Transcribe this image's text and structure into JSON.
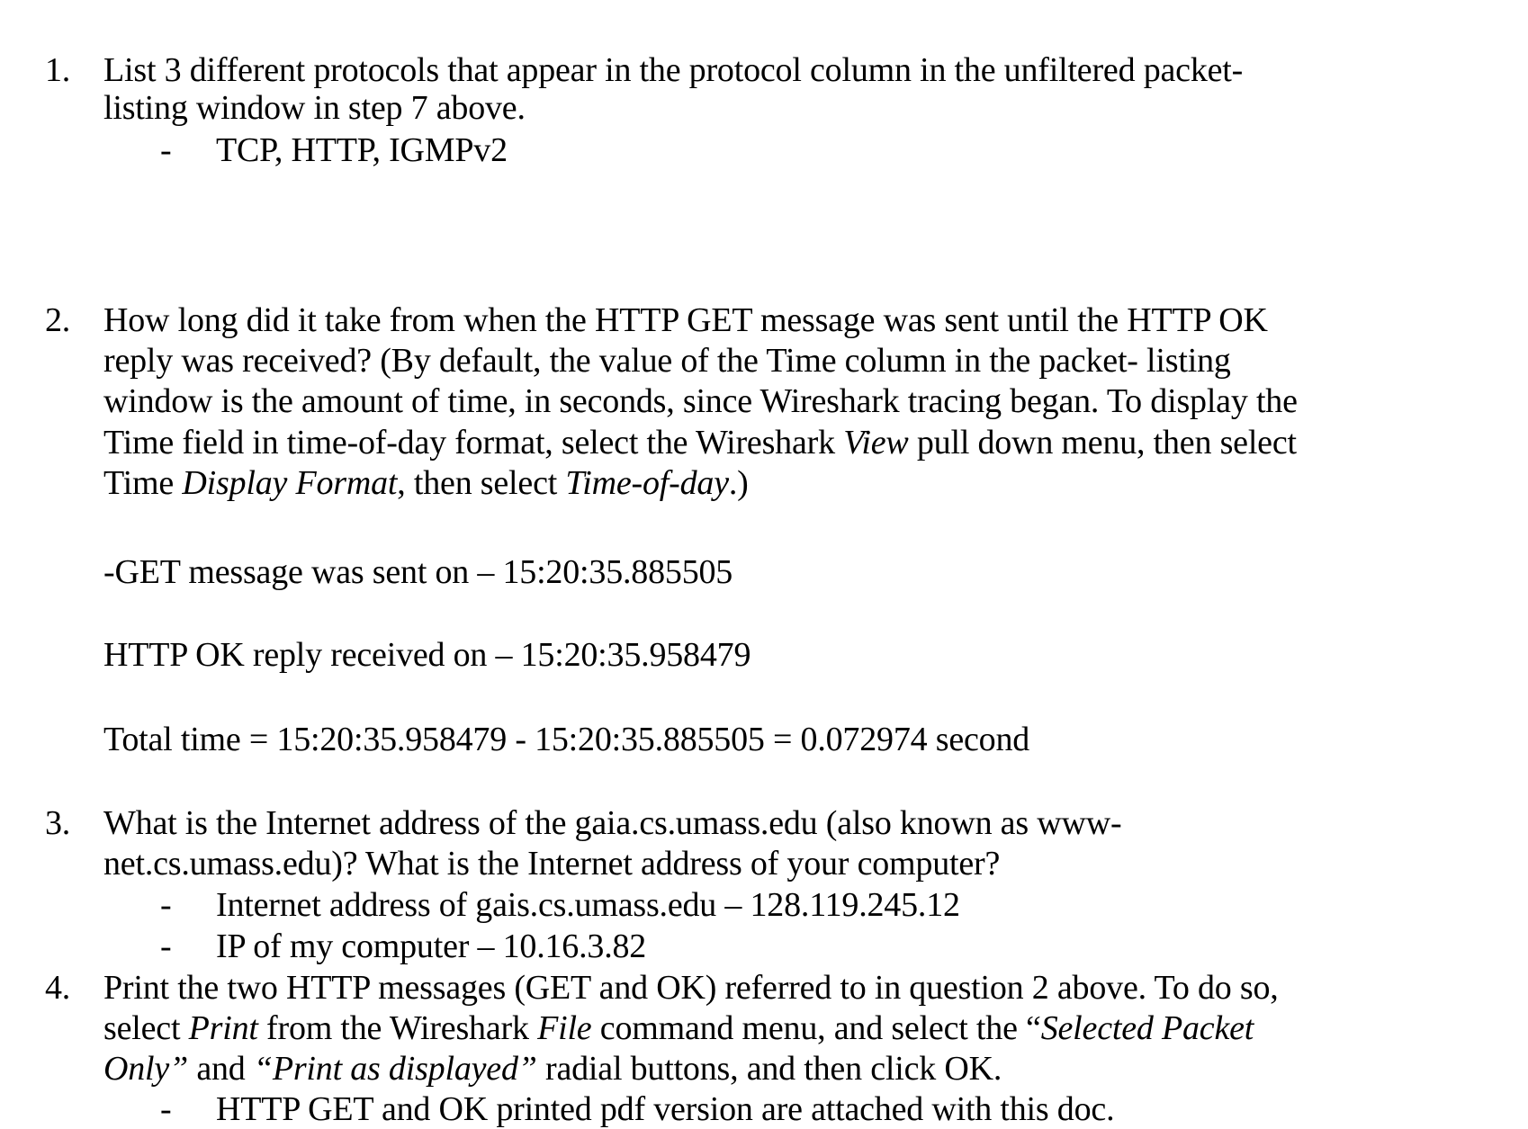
{
  "q1": {
    "number": "1.",
    "line1": "List 3 different protocols that appear in the protocol column in the unfiltered packet-",
    "line2": "listing window in step 7 above.",
    "bullet": "-",
    "answer": "TCP, HTTP, IGMPv2"
  },
  "q2": {
    "number": "2.",
    "line1": "How long did it take from when the HTTP GET message was sent until the HTTP OK",
    "line2": "reply was received? (By default, the value of the Time column in the packet- listing",
    "line3": "window is the amount of time, in seconds, since Wireshark tracing began. To display the",
    "line4a": "Time field in time-of-day format, select the Wireshark ",
    "line4b": "View",
    "line4c": " pull down menu, then select",
    "line5a": "Time ",
    "line5b": "Display Format",
    "line5c": ", then select ",
    "line5d": "Time-of-day",
    "line5e": ".)",
    "get_sent": "-GET message was sent on – 15:20:35.885505",
    "ok_received": "HTTP OK reply received on – 15:20:35.958479",
    "total": "Total time = 15:20:35.958479 - 15:20:35.885505 = 0.072974 second"
  },
  "q3": {
    "number": "3.",
    "line1": "What is the Internet address of the gaia.cs.umass.edu (also known as www-",
    "line2": "net.cs.umass.edu)? What is the Internet address of your computer?",
    "bullet": "-",
    "answer1": "Internet address of gais.cs.umass.edu – 128.119.245.12",
    "answer2": "IP of my computer – 10.16.3.82"
  },
  "q4": {
    "number": "4.",
    "line1": "Print the two HTTP messages (GET and OK) referred to in question 2 above. To do so,",
    "line2a": "select ",
    "line2b": "Print",
    "line2c": " from the Wireshark ",
    "line2d": "File",
    "line2e": " command menu, and select the “",
    "line2f": "Selected Packet",
    "line3a": "Only”",
    "line3b": " and ",
    "line3c": "“Print as displayed”",
    "line3d": " radial buttons, and then click OK.",
    "bullet": "-",
    "answer": "HTTP GET and OK printed pdf version are attached with this doc."
  }
}
